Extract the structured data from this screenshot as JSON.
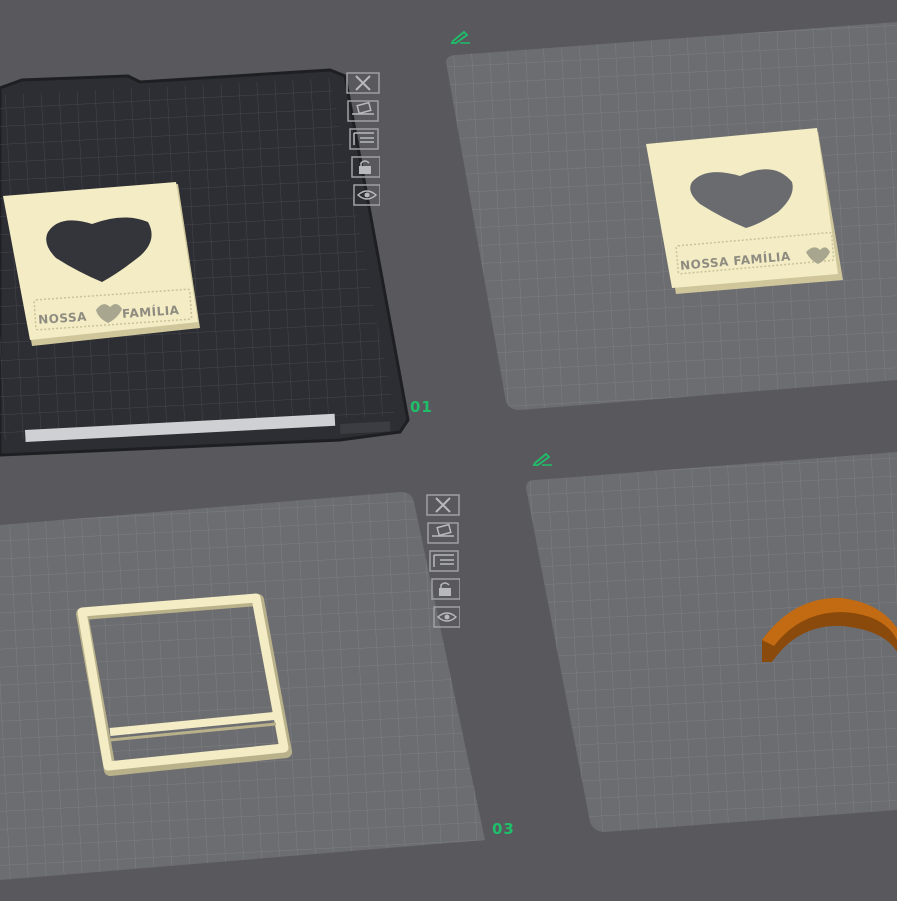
{
  "plates": [
    {
      "index": 1,
      "label": "01",
      "selected": true
    },
    {
      "index": 2,
      "label": "",
      "selected": false
    },
    {
      "index": 3,
      "label": "03",
      "selected": false
    },
    {
      "index": 4,
      "label": "",
      "selected": false
    }
  ],
  "models": {
    "frame_text_plate1": {
      "left": "NOSSA",
      "right": "FAMÍLIA"
    },
    "frame_text_plate2": {
      "full": "NOSSA FAMÍLIA"
    }
  },
  "icons": {
    "plate_tools": [
      "close-plate-icon",
      "auto-arrange-icon",
      "layout-icon",
      "lock-icon",
      "visibility-icon"
    ],
    "edit": "edit-pencil-icon"
  },
  "colors": {
    "background": "#58585d",
    "bed_dark": "#2f3035",
    "bed_light": "#6e6f73",
    "grid_line": "#84858a",
    "model_cream": "#f3ecc4",
    "model_side": "#cfc79b",
    "arc_orange": "#b8640f",
    "accent_green": "#1fbf6a"
  }
}
